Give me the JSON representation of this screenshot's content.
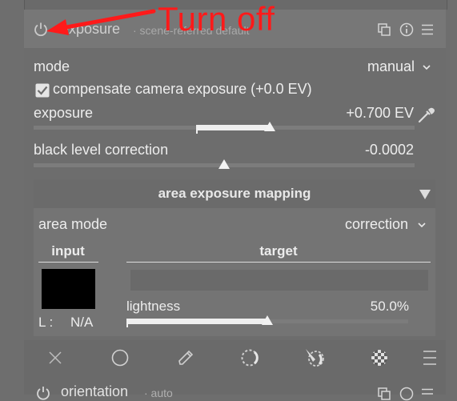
{
  "module": {
    "title": "exposure",
    "preset": "· scene-referred default",
    "icons": [
      "power-icon",
      "multi-instance-icon",
      "reset-icon",
      "presets-icon"
    ]
  },
  "annotation": {
    "text": "Turn off",
    "color": "#ff1a1a"
  },
  "mode": {
    "label": "mode",
    "value": "manual"
  },
  "compensate": {
    "label": "compensate camera exposure (+0.0 EV)",
    "checked": true
  },
  "exposure": {
    "label": "exposure",
    "value": "+0.700 EV",
    "level": 0.62
  },
  "black_level": {
    "label": "black level correction",
    "value": "-0.0002",
    "level": 0.5
  },
  "area": {
    "title": "area exposure mapping",
    "mode_label": "area mode",
    "mode_value": "correction",
    "input_label": "input",
    "target_label": "target",
    "readout_prefix": "L :",
    "readout_value": "N/A",
    "lightness_label": "lightness",
    "lightness_value": "50.0%",
    "lightness_level": 0.5
  },
  "toolbar_icons": [
    "close-icon",
    "circle-icon",
    "pencil-icon",
    "dashed-circle-icon",
    "brush-mask-icon",
    "raster-mask-icon",
    "menu-icon"
  ],
  "next_module": {
    "title": "orientation",
    "preset": "· auto"
  }
}
